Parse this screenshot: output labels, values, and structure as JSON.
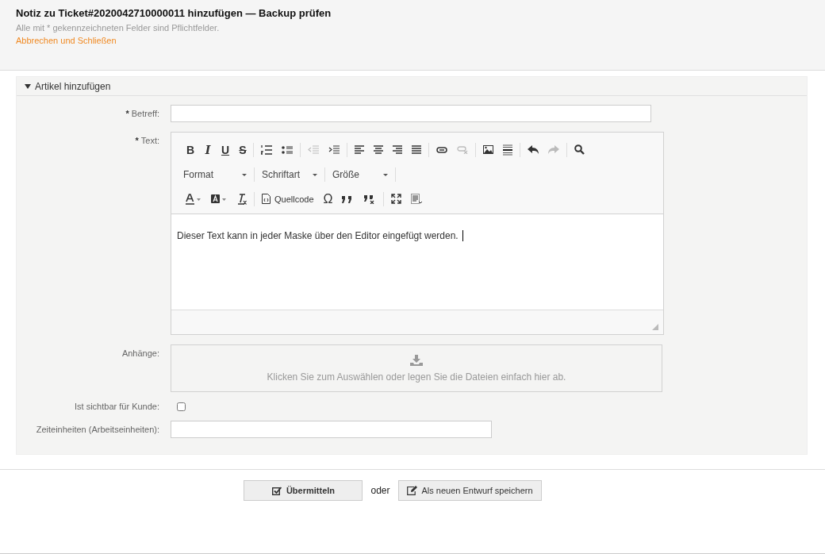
{
  "header": {
    "title": "Notiz zu Ticket#2020042710000011 hinzufügen — Backup prüfen",
    "hint": "Alle mit * gekennzeichneten Felder sind Pflichtfelder.",
    "cancel_link": "Abbrechen und Schließen"
  },
  "section": {
    "title": "Artikel hinzufügen",
    "expanded": true
  },
  "subject": {
    "required_mark": "*",
    "label": "Betreff:"
  },
  "text": {
    "required_mark": "*",
    "label": "Text:"
  },
  "editor": {
    "format_buttons": [
      "B",
      "I",
      "U",
      "S"
    ],
    "disabled": {
      "outdent": true,
      "indent": false,
      "link": false,
      "unlink": true,
      "undo": false,
      "redo": true
    },
    "dropdowns": [
      {
        "label": "Format"
      },
      {
        "label": "Schriftart"
      },
      {
        "label": "Größe"
      }
    ],
    "source_label": "Quellcode",
    "special_char": "Ω",
    "content": "Dieser Text kann in jeder Maske über den Editor eingefügt werden."
  },
  "attachments": {
    "label": "Anhänge:",
    "hint": "Klicken Sie zum Auswählen oder legen Sie die Dateien einfach hier ab."
  },
  "visible": {
    "label": "Ist sichtbar für Kunde:",
    "checked": false
  },
  "time_units": {
    "label": "Zeiteinheiten (Arbeitseinheiten):"
  },
  "footer": {
    "submit": "Übermitteln",
    "or": "oder",
    "draft": "Als neuen Entwurf speichern"
  }
}
